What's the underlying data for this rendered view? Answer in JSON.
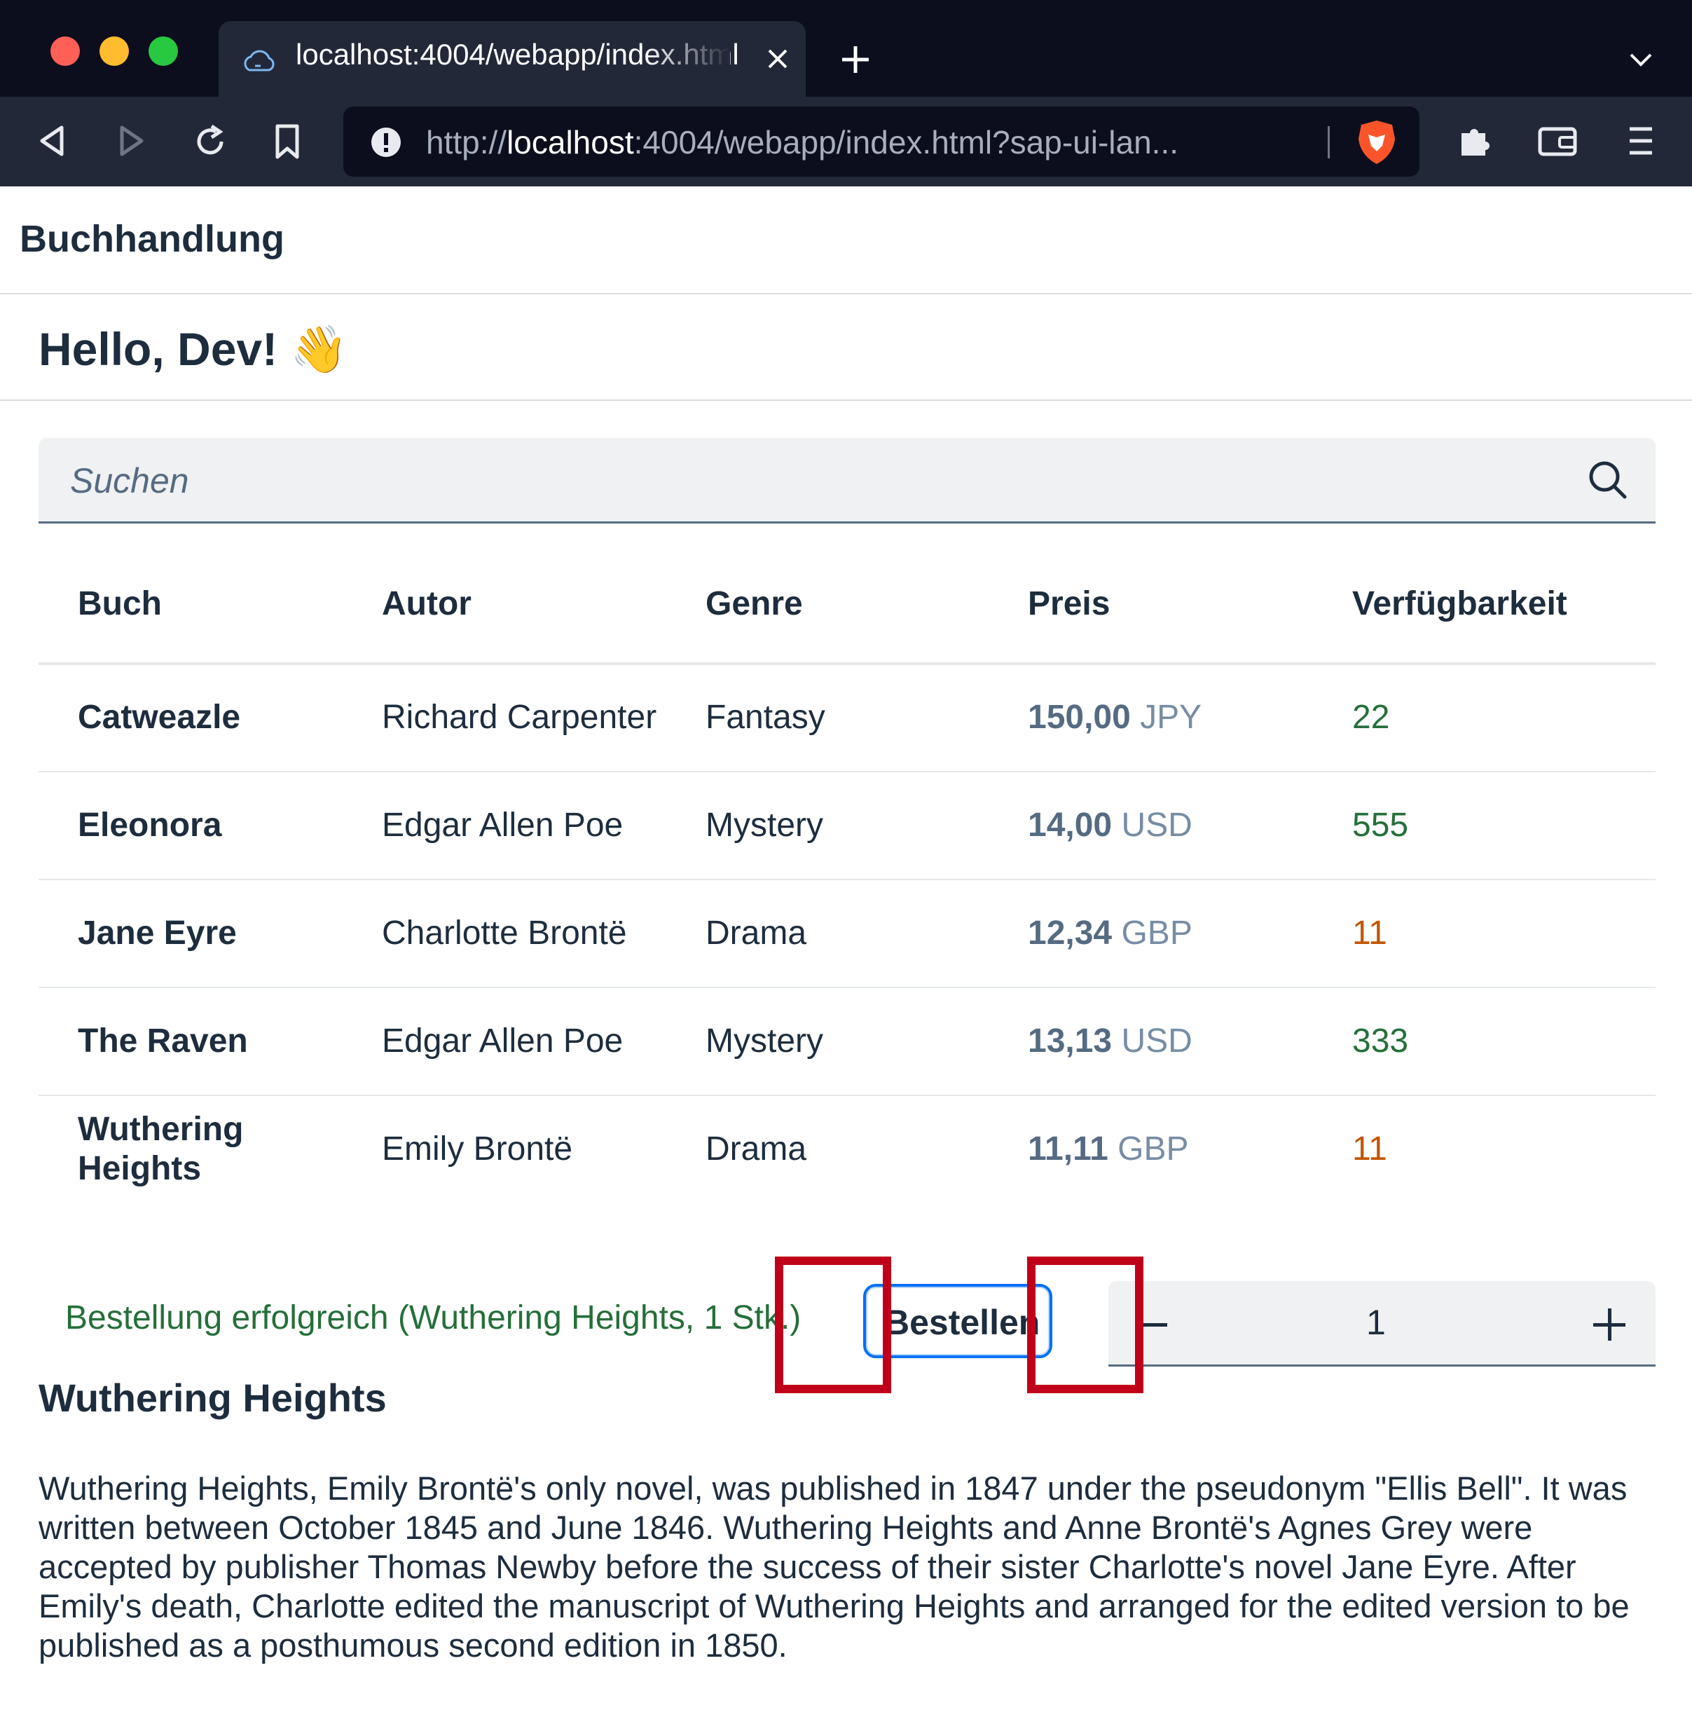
{
  "browser": {
    "tab_title": "localhost:4004/webapp/index.html",
    "url_prefix": "http://",
    "url_host": "localhost",
    "url_rest": ":4004/webapp/index.html?sap-ui-lan..."
  },
  "app": {
    "title": "Buchhandlung",
    "greeting": "Hello, Dev! 👋",
    "search_placeholder": "Suchen"
  },
  "table": {
    "columns": [
      "Buch",
      "Autor",
      "Genre",
      "Preis",
      "Verfügbarkeit"
    ],
    "rows": [
      {
        "book": "Catweazle",
        "author": "Richard Carpenter",
        "genre": "Fantasy",
        "price": "150,00",
        "currency": "JPY",
        "stock": "22",
        "stock_status": "ok"
      },
      {
        "book": "Eleonora",
        "author": "Edgar Allen Poe",
        "genre": "Mystery",
        "price": "14,00",
        "currency": "USD",
        "stock": "555",
        "stock_status": "ok"
      },
      {
        "book": "Jane Eyre",
        "author": "Charlotte Brontë",
        "genre": "Drama",
        "price": "12,34",
        "currency": "GBP",
        "stock": "11",
        "stock_status": "warn"
      },
      {
        "book": "The Raven",
        "author": "Edgar Allen Poe",
        "genre": "Mystery",
        "price": "13,13",
        "currency": "USD",
        "stock": "333",
        "stock_status": "ok"
      },
      {
        "book": "Wuthering Heights",
        "author": "Emily Brontë",
        "genre": "Drama",
        "price": "11,11",
        "currency": "GBP",
        "stock": "11",
        "stock_status": "warn"
      }
    ]
  },
  "order": {
    "message": "Bestellung erfolgreich (Wuthering Heights, 1 Stk.)",
    "button_label": "Bestellen",
    "quantity": "1"
  },
  "detail": {
    "title": "Wuthering Heights",
    "description": "Wuthering Heights, Emily Brontë's only novel, was published in 1847 under the pseudonym \"Ellis Bell\". It was written between October 1845 and June 1846. Wuthering Heights and Anne Brontë's Agnes Grey were accepted by publisher Thomas Newby before the success of their sister Charlotte's novel Jane Eyre. After Emily's death, Charlotte edited the manuscript of Wuthering Heights and arranged for the edited version to be published as a posthumous second edition in 1850."
  },
  "colors": {
    "stock_ok": "#256f3a",
    "stock_warn": "#c35500",
    "highlight": "#c0001a",
    "brand_text": "#1d2d3e"
  }
}
